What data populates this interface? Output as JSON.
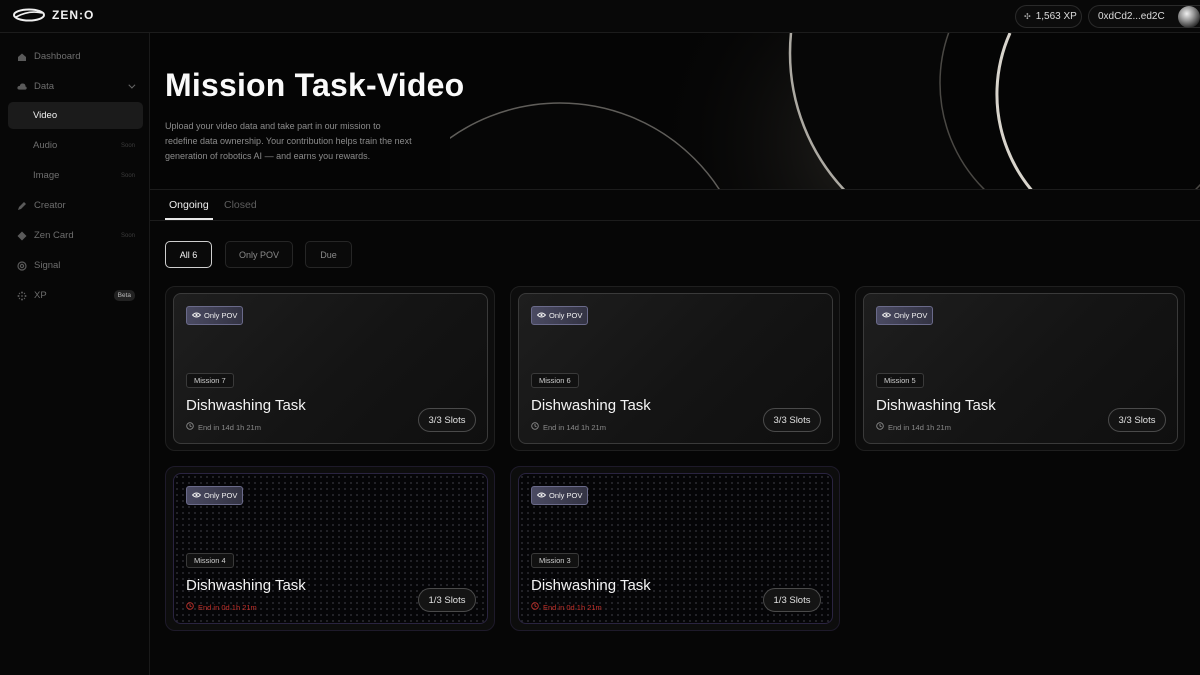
{
  "brand": {
    "name": "ZEN:O"
  },
  "topbar": {
    "xp": "1,563 XP",
    "wallet": "0xdCd2...ed2C"
  },
  "sidebar": {
    "items": [
      {
        "label": "Dashboard",
        "icon": "home-icon"
      },
      {
        "label": "Data",
        "icon": "cloud-icon"
      },
      {
        "label": "Video"
      },
      {
        "label": "Audio",
        "badge": "Soon"
      },
      {
        "label": "Image",
        "badge": "Soon"
      },
      {
        "label": "Creator",
        "icon": "pen-tool-icon"
      },
      {
        "label": "Zen Card",
        "icon": "diamond-icon",
        "badge": "Soon"
      },
      {
        "label": "Signal",
        "icon": "at-sign-icon"
      },
      {
        "label": "XP",
        "icon": "sparkle-icon",
        "badge": "Beta"
      }
    ]
  },
  "hero": {
    "title": "Mission Task-Video",
    "description": "Upload your video data and take part in our mission to redefine data ownership. Your contribution helps train the next generation of robotics AI — and earns you rewards."
  },
  "tabs": [
    "Ongoing",
    "Closed"
  ],
  "filters": [
    "All 6",
    "Only POV",
    "Due"
  ],
  "cards": [
    {
      "badge": "Only POV",
      "mission": "Mission 7",
      "title": "Dishwashing Task",
      "end": "End in 14d 1h 21m",
      "slots": "3/3 Slots",
      "urgent": false
    },
    {
      "badge": "Only POV",
      "mission": "Mission 6",
      "title": "Dishwashing Task",
      "end": "End in 14d 1h 21m",
      "slots": "3/3 Slots",
      "urgent": false
    },
    {
      "badge": "Only POV",
      "mission": "Mission 5",
      "title": "Dishwashing Task",
      "end": "End in 14d 1h 21m",
      "slots": "3/3 Slots",
      "urgent": false
    },
    {
      "badge": "Only POV",
      "mission": "Mission 4",
      "title": "Dishwashing Task",
      "end": "End in 0d 1h 21m",
      "slots": "1/3 Slots",
      "urgent": true
    },
    {
      "badge": "Only POV",
      "mission": "Mission 3",
      "title": "Dishwashing Task",
      "end": "End in 0d 1h 21m",
      "slots": "1/3 Slots",
      "urgent": true
    }
  ],
  "colors": {
    "accent": "#e8e8e8",
    "urgent": "#c0302a",
    "badge": "#4a4a62"
  }
}
